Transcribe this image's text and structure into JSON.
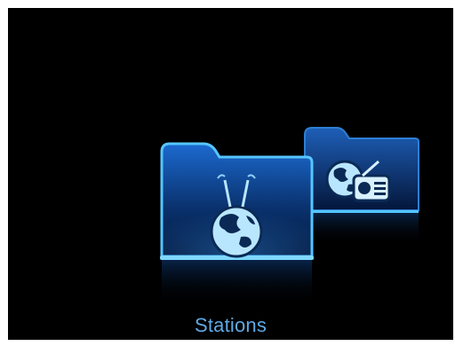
{
  "screen": {
    "caption": "Stations"
  },
  "carousel": {
    "items": [
      {
        "icon": "globe-antenna-icon",
        "selected": true
      },
      {
        "icon": "globe-radio-icon",
        "selected": false
      }
    ]
  },
  "colors": {
    "background": "#000000",
    "folder_outline": "#55c6ff",
    "folder_fill": "#0a3370",
    "caption": "#5fa9e6"
  }
}
